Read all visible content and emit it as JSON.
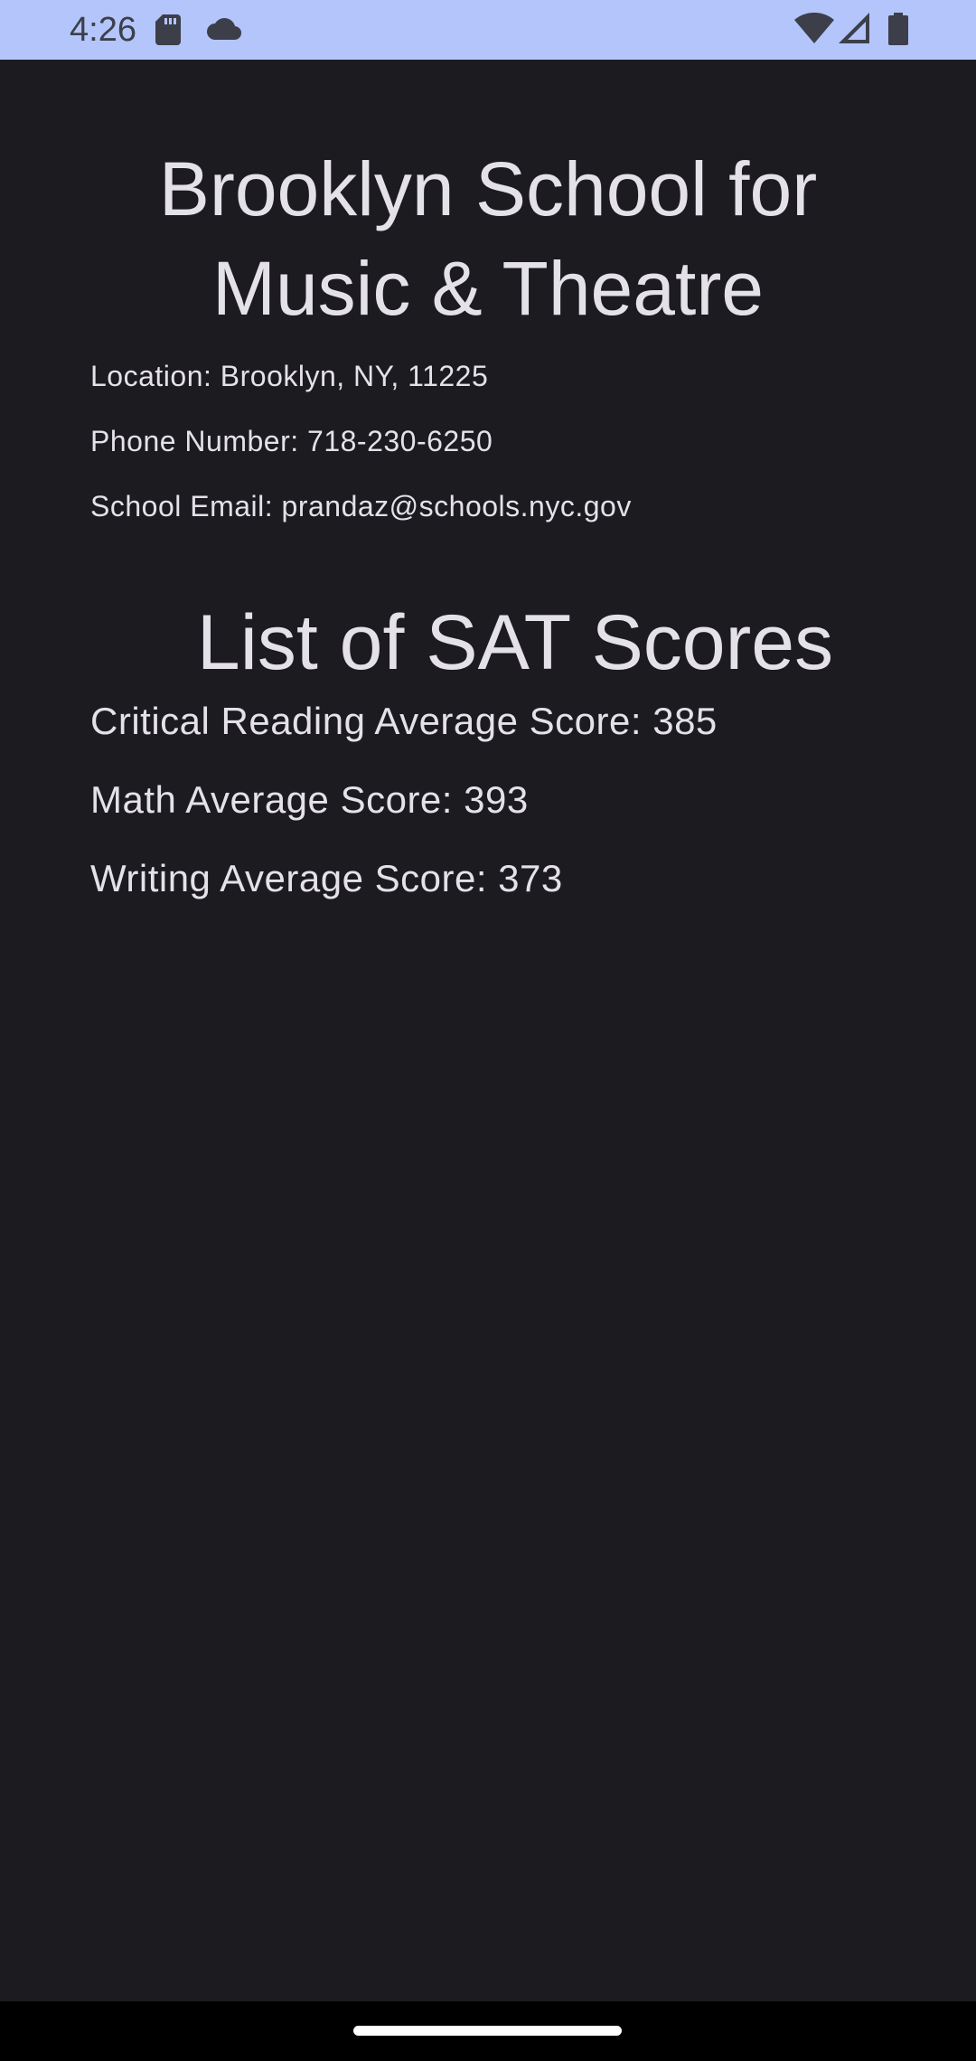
{
  "status_bar": {
    "time": "4:26",
    "background": "#b3c5fb",
    "icons": [
      "sd-card-icon",
      "cloud-icon",
      "wifi-icon",
      "signal-icon",
      "battery-icon"
    ]
  },
  "school": {
    "name": "Brooklyn School for Music & Theatre",
    "location": "Location: Brooklyn, NY, 11225",
    "phone": "Phone Number: 718-230-6250",
    "email": "School Email: prandaz@schools.nyc.gov"
  },
  "sat": {
    "heading": "List of SAT Scores",
    "critical_reading": "Critical Reading Average Score: 385",
    "math": "Math Average Score: 393",
    "writing": "Writing Average Score: 373"
  },
  "colors": {
    "background": "#1c1b20",
    "text": "#e4e1e8",
    "nav_bar": "#000000"
  }
}
